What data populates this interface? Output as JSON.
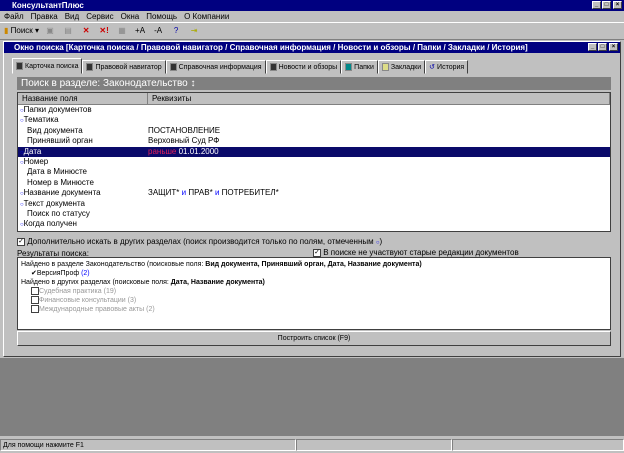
{
  "app": {
    "title": "КонсультантПлюс"
  },
  "menu": [
    "Файл",
    "Правка",
    "Вид",
    "Сервис",
    "Окна",
    "Помощь",
    "О Компании"
  ],
  "toolbar": {
    "search": "Поиск",
    "font_up": "+A",
    "font_down": "-A"
  },
  "window": {
    "title": "Окно поиска [Карточка поиска / Правовой навигатор / Справочная информация / Новости и обзоры / Папки / Закладки / История]"
  },
  "tabs": [
    "Карточка поиска",
    "Правовой навигатор",
    "Справочная информация",
    "Новости и обзоры",
    "Папки",
    "Закладки",
    "История"
  ],
  "section": "Поиск в разделе: Законодательство",
  "table": {
    "headers": [
      "Название поля",
      "Реквизиты"
    ],
    "rows": [
      {
        "name": "Папки документов",
        "marked": true,
        "value": ""
      },
      {
        "name": "Тематика",
        "marked": true,
        "value": ""
      },
      {
        "name": "Вид документа",
        "marked": false,
        "value": "ПОСТАНОВЛЕНИЕ"
      },
      {
        "name": "Принявший орган",
        "marked": false,
        "value": "Верховный Суд РФ"
      },
      {
        "name": "Дата",
        "marked": true,
        "prefix": "раньше",
        "value": "01.01.2000",
        "selected": true
      },
      {
        "name": "Номер",
        "marked": true,
        "value": ""
      },
      {
        "name": "Дата в Минюсте",
        "marked": false,
        "value": ""
      },
      {
        "name": "Номер в Минюсте",
        "marked": false,
        "value": ""
      },
      {
        "name": "Название документа",
        "marked": true,
        "terms": [
          "ЗАЩИТ*",
          "и",
          "ПРАВ*",
          "и",
          "ПОТРЕБИТЕЛ*"
        ]
      },
      {
        "name": "Текст документа",
        "marked": true,
        "value": ""
      },
      {
        "name": "Поиск по статусу",
        "marked": false,
        "value": ""
      },
      {
        "name": "Когда получен",
        "marked": true,
        "value": ""
      }
    ]
  },
  "options": {
    "extra_search": "Дополнительно искать в других разделах (поиск производится только по полям, отмеченным",
    "extra_search_end": ")",
    "old_editions": "В поиске не участвуют старые редакции документов"
  },
  "results": {
    "label": "Результаты поиска:",
    "found_main": "Найдено в разделе Законодательство (поисковые поля:",
    "found_main_fields": "Вид документа, Принявший орган, Дата, Название документа)",
    "main_items": [
      {
        "label": "ВерсияПроф",
        "count": "(2)"
      }
    ],
    "found_other": "Найдено в других разделах (поисковые поля:",
    "found_other_fields": "Дата, Название документа)",
    "other_items": [
      "Судебная практика (19)",
      "Финансовые консультации (3)",
      "Международные правовые акты (2)"
    ]
  },
  "build_button": "Построить список (F9)",
  "status": "Для помощи нажмите F1"
}
